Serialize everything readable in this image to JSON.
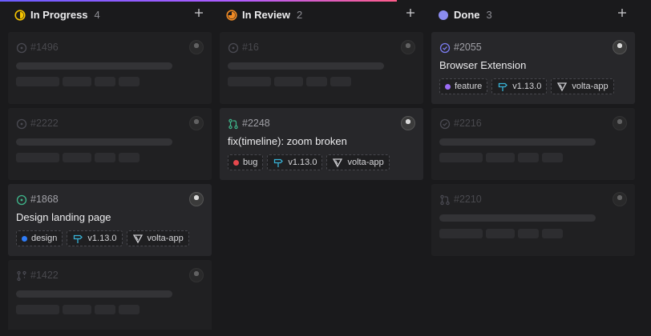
{
  "board": {
    "columns": [
      {
        "title": "In Progress",
        "count": "4",
        "status_icon": "half-circle-icon",
        "status_color": "#f5c400",
        "cards": [
          {
            "id": "#1496",
            "ghost": true,
            "icon": "open-circle-icon"
          },
          {
            "id": "#2222",
            "ghost": true,
            "icon": "open-circle-icon"
          },
          {
            "id": "#1868",
            "ghost": false,
            "icon": "open-circle-icon",
            "title": "Design landing page",
            "tags": [
              {
                "label": "design",
                "dot": "#2f7cf6"
              },
              {
                "label": "v1.13.0",
                "kind": "milestone"
              },
              {
                "label": "volta-app",
                "kind": "project"
              }
            ]
          },
          {
            "id": "#1422",
            "ghost": true,
            "icon": "branch-icon"
          }
        ]
      },
      {
        "title": "In Review",
        "count": "2",
        "status_icon": "partial-circle-icon",
        "status_color": "#f08a24",
        "cards": [
          {
            "id": "#16",
            "ghost": true,
            "icon": "open-circle-icon"
          },
          {
            "id": "#2248",
            "ghost": false,
            "icon": "pull-request-icon",
            "title": "fix(timeline): zoom broken",
            "tags": [
              {
                "label": "bug",
                "dot": "#e5484d"
              },
              {
                "label": "v1.13.0",
                "kind": "milestone"
              },
              {
                "label": "volta-app",
                "kind": "project"
              }
            ]
          }
        ]
      },
      {
        "title": "Done",
        "count": "3",
        "status_icon": "filled-circle-icon",
        "status_color": "#8b8cf0",
        "cards": [
          {
            "id": "#2055",
            "ghost": false,
            "icon": "check-circle-icon",
            "title": "Browser Extension",
            "tags": [
              {
                "label": "feature",
                "dot": "#9b6cf5"
              },
              {
                "label": "v1.13.0",
                "kind": "milestone"
              },
              {
                "label": "volta-app",
                "kind": "project"
              }
            ]
          },
          {
            "id": "#2216",
            "ghost": true,
            "icon": "check-circle-icon"
          },
          {
            "id": "#2210",
            "ghost": true,
            "icon": "pull-request-icon"
          }
        ]
      }
    ]
  },
  "colors": {
    "open": "#3fb68b",
    "done": "#7b7cf0",
    "milestone": "#38b2d6",
    "ghost_icon": "#4a4a52"
  }
}
